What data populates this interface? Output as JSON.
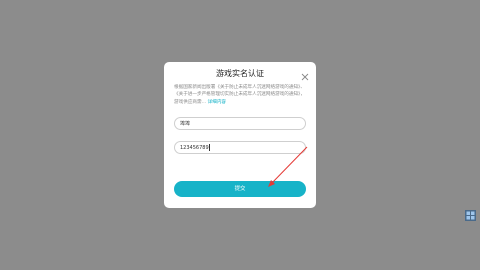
{
  "dialog": {
    "title": "游戏实名认证",
    "notice_text": "根据国家新闻出版署《关于防止未成年人沉迷网络游戏的通知》、《关于进一步严格管理切实防止未成年人沉迷网络游戏的通知》，游戏供应商需…",
    "notice_link": "详细内容",
    "name_value": "埠埠",
    "id_value": "123456789",
    "submit_label": "提交"
  },
  "colors": {
    "backdrop": "#8c8c8c",
    "accent": "#17b3c8",
    "annotation_arrow": "#e53935"
  },
  "icons": {
    "close": "close-icon",
    "windows": "windows-icon"
  }
}
